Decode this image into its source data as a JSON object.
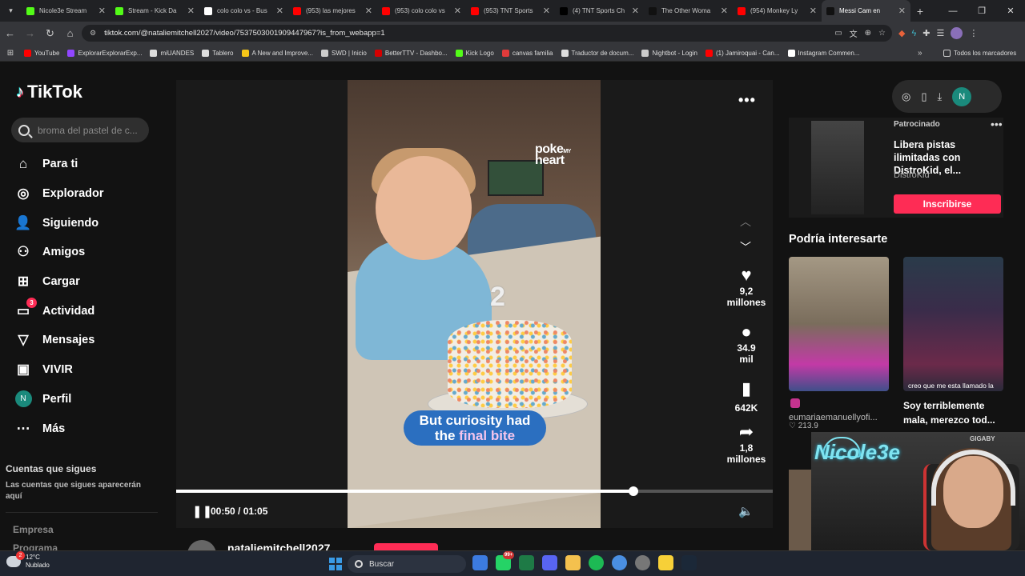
{
  "browser": {
    "tabs": [
      {
        "title": "Nicole3e Stream",
        "icon": "kick-icon",
        "color": "#53fc18"
      },
      {
        "title": "Stream - Kick Da",
        "icon": "kick-icon",
        "color": "#53fc18"
      },
      {
        "title": "colo colo vs - Bus",
        "icon": "google-icon",
        "color": "#ffffff"
      },
      {
        "title": "(953) las mejores",
        "icon": "youtube-icon",
        "color": "#ff0000"
      },
      {
        "title": "(953) colo colo vs",
        "icon": "youtube-icon",
        "color": "#ff0000"
      },
      {
        "title": "(953) TNT Sports",
        "icon": "youtube-icon",
        "color": "#ff0000"
      },
      {
        "title": "(4) TNT Sports Ch",
        "icon": "x-icon",
        "color": "#000000"
      },
      {
        "title": "The Other Woma",
        "icon": "tiktok-icon",
        "color": "#111111"
      },
      {
        "title": "(954) Monkey Ly",
        "icon": "youtube-icon",
        "color": "#ff0000"
      },
      {
        "title": "Messi Cam en",
        "icon": "tiktok-icon",
        "color": "#111111",
        "active": true
      }
    ],
    "url": "tiktok.com/@nataliemitchell2027/video/7537503001909447967?is_from_webapp=1",
    "bookmarks": [
      {
        "label": "YouTube",
        "color": "#ff0000"
      },
      {
        "label": "ExplorarExplorarExp...",
        "color": "#9146ff"
      },
      {
        "label": "miUANDES",
        "color": "#dddddd"
      },
      {
        "label": "Tablero",
        "color": "#dddddd"
      },
      {
        "label": "A New and Improve...",
        "color": "#f5c518"
      },
      {
        "label": "SWD | Inicio",
        "color": "#cccccc"
      },
      {
        "label": "BetterTTV - Dashbo...",
        "color": "#d50000"
      },
      {
        "label": "Kick Logo",
        "color": "#53fc18"
      },
      {
        "label": "canvas familia",
        "color": "#e13b3b"
      },
      {
        "label": "Traductor de docum...",
        "color": "#dddddd"
      },
      {
        "label": "Nightbot - Login",
        "color": "#cccccc"
      },
      {
        "label": "(1) Jamiroquai - Can...",
        "color": "#ff0000"
      },
      {
        "label": "Instagram Commen...",
        "color": "#ffffff"
      }
    ],
    "bookmarks_all": "Todos los marcadores"
  },
  "tiktok": {
    "logo": "TikTok",
    "search_placeholder": "broma del pastel de c...",
    "nav": [
      {
        "label": "Para ti",
        "icon": "home-icon"
      },
      {
        "label": "Explorador",
        "icon": "compass-icon"
      },
      {
        "label": "Siguiendo",
        "icon": "following-icon"
      },
      {
        "label": "Amigos",
        "icon": "friends-icon"
      },
      {
        "label": "Cargar",
        "icon": "upload-icon"
      },
      {
        "label": "Actividad",
        "icon": "inbox-icon",
        "badge": "3"
      },
      {
        "label": "Mensajes",
        "icon": "messages-icon"
      },
      {
        "label": "VIVIR",
        "icon": "live-icon"
      },
      {
        "label": "Perfil",
        "icon": "profile-avatar",
        "initial": "N"
      },
      {
        "label": "Más",
        "icon": "more-icon"
      }
    ],
    "following_heading": "Cuentas que sigues",
    "following_empty": "Las cuentas que sigues aparecerán aquí",
    "footer": [
      "Empresa",
      "Programa"
    ]
  },
  "video": {
    "brand": "poke",
    "brand_small": "MY",
    "brand2": "heart",
    "caption_pre": "But curiosity had",
    "caption_mid": "the",
    "caption_hl": "final bite",
    "candle": "2",
    "time": "00:50 / 01:05",
    "progress": 0.767,
    "likes": "9,2 millones",
    "comments": "34.9 mil",
    "saves": "642K",
    "shares": "1,8 millones",
    "author": "nataliemitchell2027"
  },
  "right": {
    "profile_initial": "N",
    "ad": {
      "sponsor": "Patrocinado",
      "title": "Libera pistas ilimitadas con DistroKid, el...",
      "brand": "DistroKid",
      "button": "Inscribirse"
    },
    "suggest_heading": "Podría interesarte",
    "card_a": {
      "user": "eumariaemanuellyofi...",
      "likes": "213.9"
    },
    "card_b": {
      "overlay": "creo que me esta llamado la",
      "caption": "Soy terriblemente mala, merezco tod..."
    }
  },
  "webcam": {
    "brand": "GIGABY",
    "logo": "Nicole3e"
  },
  "taskbar": {
    "temp": "12°C",
    "condition": "Nublado",
    "weather_badge": "2",
    "search": "Buscar",
    "badge_whatsapp": "99+"
  }
}
